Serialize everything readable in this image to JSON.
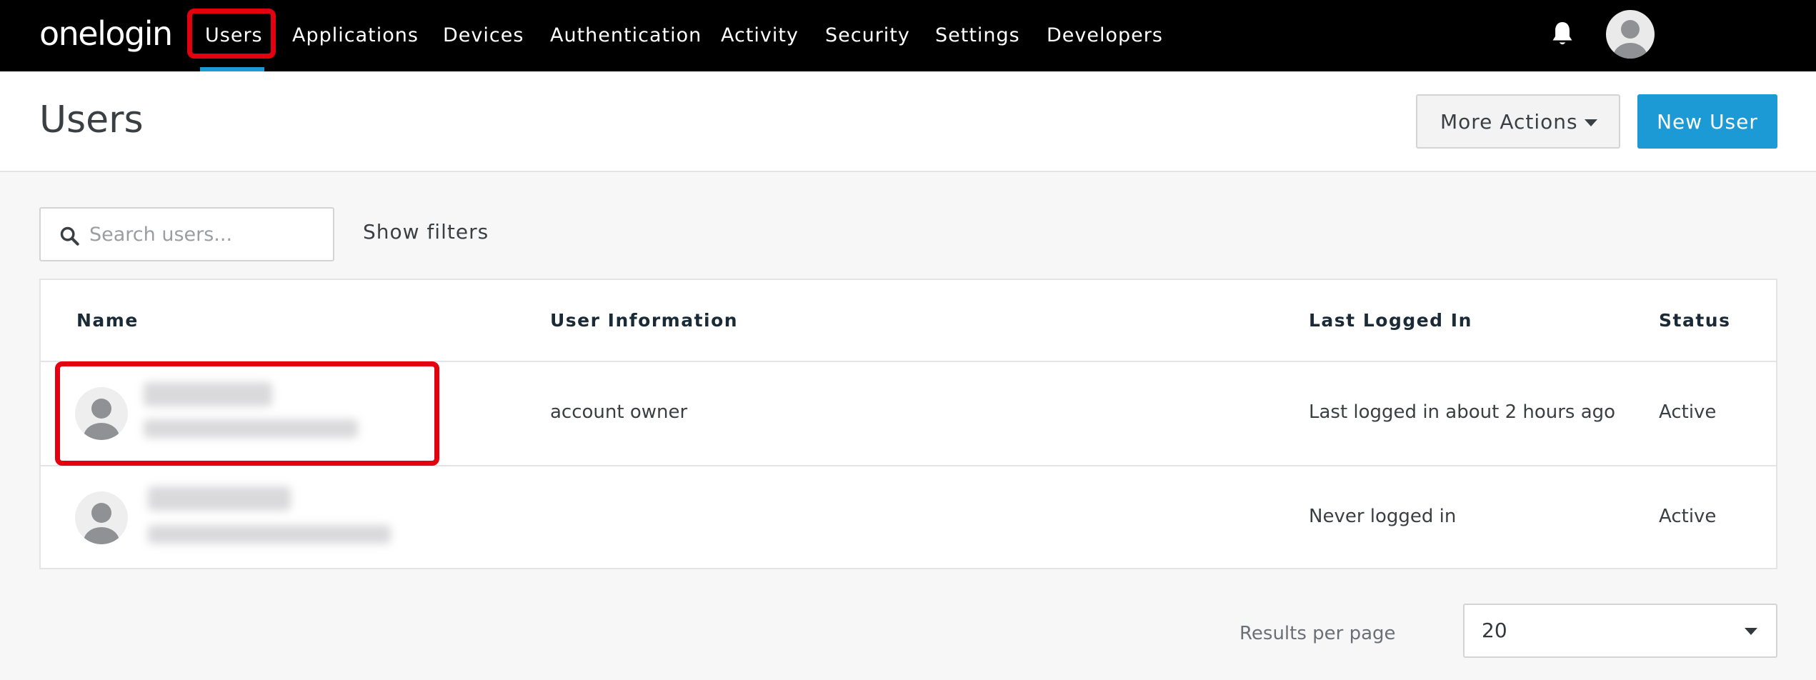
{
  "brand": {
    "logo_text": "onelogin"
  },
  "nav": {
    "items": [
      {
        "label": "Users",
        "active": true
      },
      {
        "label": "Applications"
      },
      {
        "label": "Devices"
      },
      {
        "label": "Authentication"
      },
      {
        "label": "Activity"
      },
      {
        "label": "Security"
      },
      {
        "label": "Settings"
      },
      {
        "label": "Developers"
      }
    ],
    "accent_color": "#1b9ad6"
  },
  "icons": {
    "notifications": "bell-icon",
    "profile": "avatar-icon",
    "search": "search-icon",
    "dropdown": "caret-down-icon"
  },
  "header": {
    "title": "Users",
    "more_actions_label": "More Actions",
    "new_user_label": "New User",
    "primary_color": "#1b9ad6"
  },
  "search": {
    "placeholder": "Search users...",
    "value": ""
  },
  "filters": {
    "show_label": "Show filters"
  },
  "table": {
    "columns": [
      "Name",
      "User Information",
      "Last Logged In",
      "Status"
    ],
    "rows": [
      {
        "name": "",
        "email": "",
        "info": "account owner",
        "last_login": "Last logged in about 2 hours ago",
        "status": "Active"
      },
      {
        "name": "",
        "email": "",
        "info": "",
        "last_login": "Never logged in",
        "status": "Active"
      }
    ]
  },
  "pagination": {
    "results_label": "Results per page",
    "per_page": "20"
  },
  "annotation": {
    "highlight_color": "#e3000f"
  }
}
